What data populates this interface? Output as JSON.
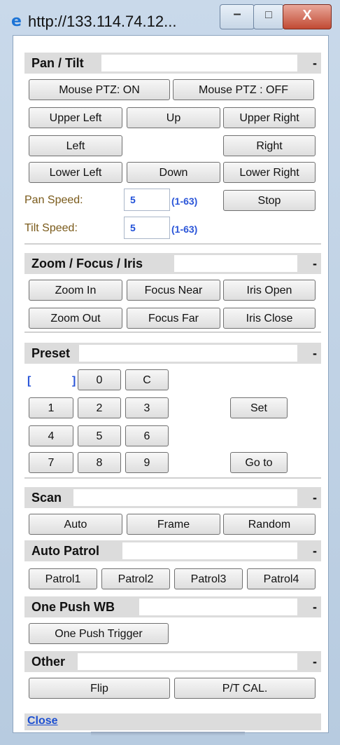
{
  "window": {
    "title": "http://133.114.74.12...",
    "minimize": "–",
    "maximize": "□",
    "close": "X"
  },
  "pan_tilt": {
    "title": "Pan / Tilt",
    "collapse": "-",
    "mouse_on": "Mouse PTZ: ON",
    "mouse_off": "Mouse PTZ : OFF",
    "upper_left": "Upper Left",
    "up": "Up",
    "upper_right": "Upper Right",
    "left": "Left",
    "right": "Right",
    "lower_left": "Lower Left",
    "down": "Down",
    "lower_right": "Lower Right",
    "pan_speed_label": "Pan Speed:",
    "pan_speed_value": "5",
    "pan_range": "(1-63)",
    "stop": "Stop",
    "tilt_speed_label": "Tilt Speed:",
    "tilt_speed_value": "5",
    "tilt_range": "(1-63)"
  },
  "zoom": {
    "title": "Zoom / Focus / Iris",
    "collapse": "-",
    "zoom_in": "Zoom In",
    "focus_near": "Focus Near",
    "iris_open": "Iris Open",
    "zoom_out": "Zoom Out",
    "focus_far": "Focus Far",
    "iris_close": "Iris Close"
  },
  "preset": {
    "title": "Preset",
    "collapse": "-",
    "bracket_open": "[",
    "bracket_close": "]",
    "zero": "0",
    "clear": "C",
    "one": "1",
    "two": "2",
    "three": "3",
    "four": "4",
    "five": "5",
    "six": "6",
    "seven": "7",
    "eight": "8",
    "nine": "9",
    "set": "Set",
    "goto": "Go to"
  },
  "scan": {
    "title": "Scan",
    "collapse": "-",
    "auto": "Auto",
    "frame": "Frame",
    "random": "Random"
  },
  "patrol": {
    "title": "Auto Patrol",
    "collapse": "-",
    "p1": "Patrol1",
    "p2": "Patrol2",
    "p3": "Patrol3",
    "p4": "Patrol4"
  },
  "wb": {
    "title": "One Push WB",
    "collapse": "-",
    "trigger": "One Push Trigger"
  },
  "other": {
    "title": "Other",
    "collapse": "-",
    "flip": "Flip",
    "ptcal": "P/T CAL."
  },
  "footer": {
    "close": "Close"
  }
}
